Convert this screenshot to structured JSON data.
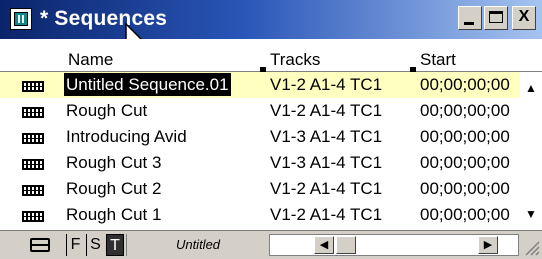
{
  "window": {
    "title": "* Sequences",
    "minimize_label": "_",
    "close_label": "X"
  },
  "columns": {
    "name": "Name",
    "tracks": "Tracks",
    "start": "Start"
  },
  "rows": [
    {
      "name": "Untitled Sequence.01",
      "tracks": "V1-2 A1-4 TC1",
      "start": "00;00;00;00",
      "selected": true,
      "icon": "sequence-icon"
    },
    {
      "name": "Rough Cut",
      "tracks": "V1-2 A1-4 TC1",
      "start": "00;00;00;00",
      "icon": "sequence-icon"
    },
    {
      "name": "Introducing Avid",
      "tracks": "V1-3 A1-4 TC1",
      "start": "00;00;00;00",
      "icon": "sequence-icon"
    },
    {
      "name": "Rough Cut 3",
      "tracks": "V1-3 A1-4 TC1",
      "start": "00;00;00;00",
      "icon": "sequence-icon"
    },
    {
      "name": "Rough Cut 2",
      "tracks": "V1-2 A1-4 TC1",
      "start": "00;00;00;00",
      "icon": "sequence-icon"
    },
    {
      "name": "Rough Cut 1",
      "tracks": "V1-2 A1-4 TC1",
      "start": "00;00;00;00",
      "icon": "sequence-icon"
    }
  ],
  "bottombar": {
    "tab_f": "F",
    "tab_s": "S",
    "tab_t": "T",
    "view_name": "Untitled"
  },
  "colors": {
    "selected_row": "#ffffc0",
    "titlebar_start": "#0a246a",
    "titlebar_end": "#a6c4f0"
  }
}
